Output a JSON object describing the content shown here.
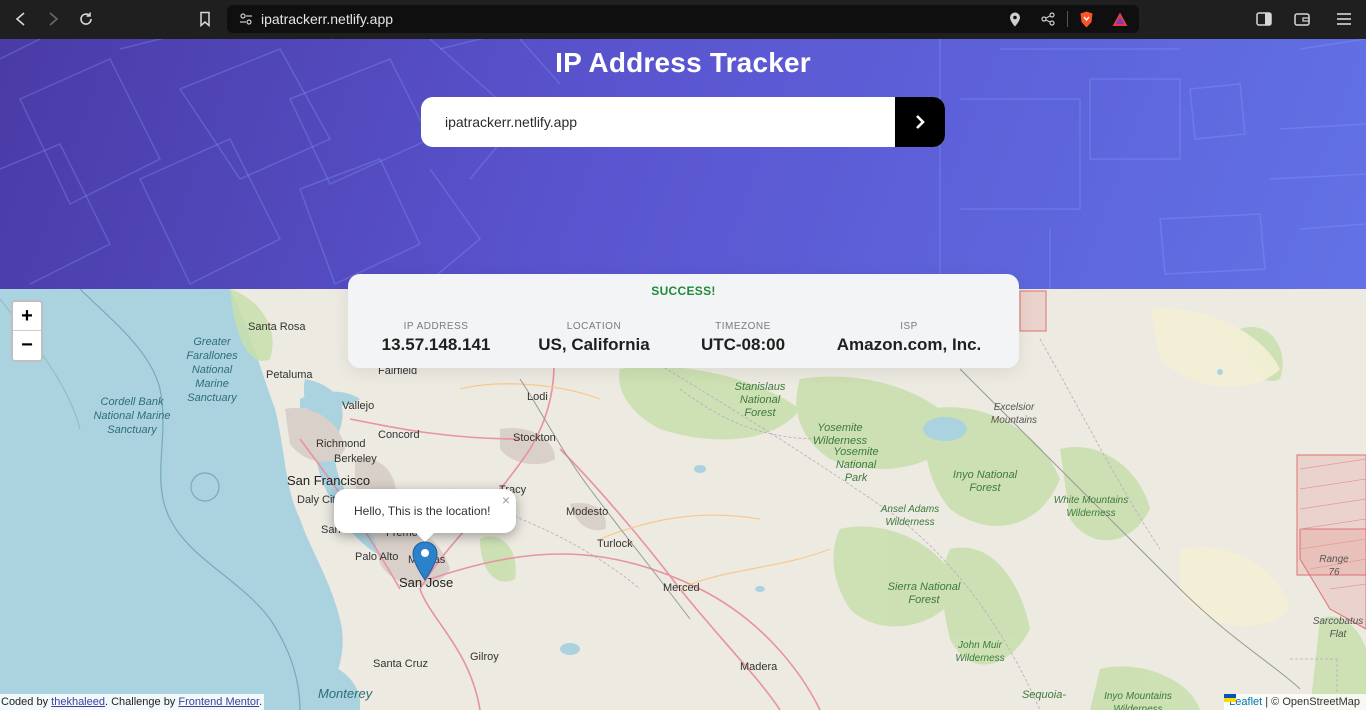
{
  "browser": {
    "url": "ipatrackerr.netlify.app"
  },
  "header": {
    "title": "IP Address Tracker",
    "search_value": "ipatrackerr.netlify.app"
  },
  "info": {
    "status": "SUCCESS!",
    "fields": [
      {
        "label": "IP ADDRESS",
        "value": "13.57.148.141"
      },
      {
        "label": "LOCATION",
        "value": "US, California"
      },
      {
        "label": "TIMEZONE",
        "value": "UTC-08:00"
      },
      {
        "label": "ISP",
        "value": "Amazon.com, Inc."
      }
    ]
  },
  "map": {
    "zoom_in": "+",
    "zoom_out": "−",
    "popup_text": "Hello, This is the location!",
    "popup_close": "×",
    "attribution_leaflet": "Leaflet",
    "attribution_rest": "| © OpenStreetMap",
    "places": {
      "santa_rosa": "Santa Rosa",
      "petaluma": "Petaluma",
      "fairfield": "Fairfield",
      "vallejo": "Vallejo",
      "concord": "Concord",
      "richmond": "Richmond",
      "berkeley": "Berkeley",
      "san_francisco": "San Francisco",
      "daly_city": "Daly City",
      "san_mateo": "San",
      "fremont": "Fremo",
      "milpitas": "Milpitas",
      "palo_alto": "Palo Alto",
      "san_jose": "San Jose",
      "santa_cruz": "Santa Cruz",
      "gilroy": "Gilroy",
      "lodi": "Lodi",
      "stockton": "Stockton",
      "tracy": "Tracy",
      "modesto": "Modesto",
      "turlock": "Turlock",
      "merced": "Merced",
      "madera": "Madera"
    },
    "areas": {
      "greater_farallones": "Greater Farallones National Marine Sanctuary",
      "cordell": "Cordell Bank National Marine Sanctuary",
      "stanislaus": "Stanislaus National Forest",
      "yosemite_wild": "Yosemite Wilderness",
      "yosemite_np": "Yosemite National Park",
      "ansel": "Ansel Adams Wilderness",
      "inyo": "Inyo National Forest",
      "sierra": "Sierra National Forest",
      "john_muir": "John Muir Wilderness",
      "excelsior": "Excelsior Mountains",
      "white_mountains": "White Mountains Wilderness",
      "range76": "Range 76",
      "sarcobatus": "Sarcobatus Flat",
      "sequoia": "Sequoia-",
      "inyo_mountains": "Inyo Mountains Wilderness",
      "monterey": "Monterey"
    }
  },
  "footer": {
    "coded_by": "Coded by",
    "author": "thekhaleed",
    "challenge_by": ". Challenge by",
    "challenge_link": "Frontend Mentor",
    "end": "."
  }
}
